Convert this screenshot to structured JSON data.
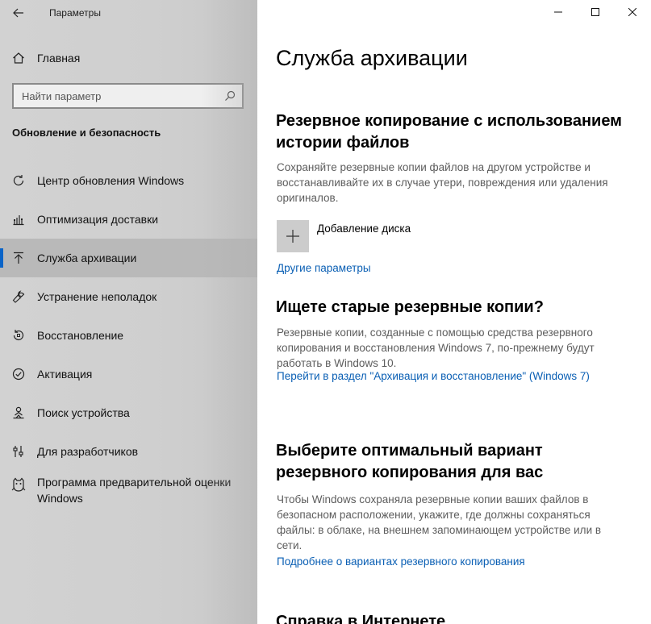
{
  "window": {
    "title": "Параметры"
  },
  "sidebar": {
    "home_label": "Главная",
    "search": {
      "placeholder": "Найти параметр"
    },
    "section_title": "Обновление и безопасность",
    "items": [
      {
        "label": "Центр обновления Windows",
        "icon": "refresh-icon"
      },
      {
        "label": "Оптимизация доставки",
        "icon": "delivery-optimization-icon"
      },
      {
        "label": "Служба архивации",
        "icon": "backup-arrow-up-icon",
        "active": true
      },
      {
        "label": "Устранение неполадок",
        "icon": "wrench-icon"
      },
      {
        "label": "Восстановление",
        "icon": "recovery-icon"
      },
      {
        "label": "Активация",
        "icon": "check-circle-icon"
      },
      {
        "label": "Поиск устройства",
        "icon": "person-location-icon"
      },
      {
        "label": "Для разработчиков",
        "icon": "developer-sliders-icon"
      },
      {
        "label": "Программа предварительной оценки Windows",
        "icon": "insider-cat-icon"
      }
    ]
  },
  "main": {
    "page_title": "Служба архивации",
    "file_history": {
      "heading": "Резервное копирование с использованием истории файлов",
      "description": "Сохраняйте резервные копии файлов на другом устройстве и восстанавливайте их в случае утери, повреждения или удаления оригиналов.",
      "add_drive_label": "Добавление диска",
      "more_options_link": "Другие параметры"
    },
    "old_backups": {
      "heading": "Ищете старые резервные копии?",
      "description": "Резервные копии, созданные с помощью средства резервного копирования и восстановления Windows 7, по-прежнему будут работать в Windows 10.",
      "link": "Перейти в раздел \"Архивация и восстановление\" (Windows 7)"
    },
    "choose_option": {
      "heading": "Выберите оптимальный вариант резервного копирования для вас",
      "description": "Чтобы Windows сохраняла резервные копии ваших файлов в безопасном расположении, укажите, где должны сохраняться файлы: в облаке, на внешнем запоминающем устройстве или в сети.",
      "link": "Подробнее о вариантах резервного копирования"
    },
    "help": {
      "heading": "Справка в Интернете"
    }
  },
  "colors": {
    "accent": "#0a64c8",
    "link": "#0a5fb4",
    "sidebar_bg": "#d0d0d0",
    "active_item_bg": "#b9b9b9"
  }
}
